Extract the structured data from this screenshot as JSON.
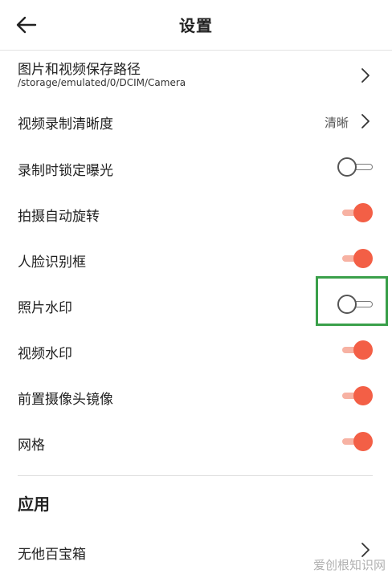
{
  "header": {
    "title": "设置"
  },
  "settings": {
    "save_path": {
      "label": "图片和视频保存路径",
      "path": "/storage/emulated/0/DCIM/Camera"
    },
    "video_quality": {
      "label": "视频录制清晰度",
      "value": "清晰"
    },
    "lock_exposure": {
      "label": "录制时锁定曝光",
      "on": false
    },
    "auto_rotate": {
      "label": "拍摄自动旋转",
      "on": true
    },
    "face_detect": {
      "label": "人脸识别框",
      "on": true
    },
    "photo_watermark": {
      "label": "照片水印",
      "on": false
    },
    "video_watermark": {
      "label": "视频水印",
      "on": true
    },
    "front_mirror": {
      "label": "前置摄像头镜像",
      "on": true
    },
    "grid": {
      "label": "网格",
      "on": true
    }
  },
  "apps_section": {
    "title": "应用",
    "toolbox": {
      "label": "无他百宝箱"
    }
  },
  "watermark_text": "爱创根知识网",
  "colors": {
    "toggle_on_knob": "#f35f46",
    "toggle_on_track": "#f7b2a3",
    "highlight": "#3aa04a"
  }
}
